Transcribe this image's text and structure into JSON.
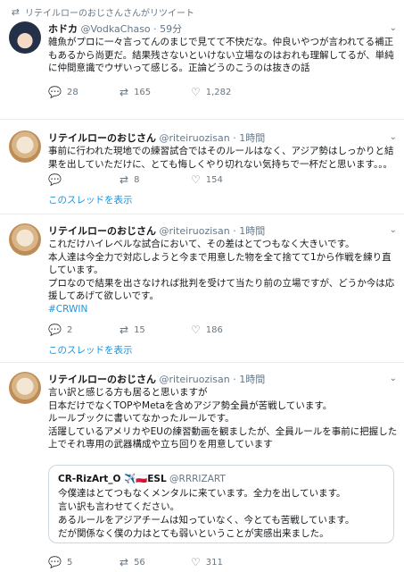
{
  "retweet_notice": "リテイルローのおじさんさんがリツイート",
  "tweets": [
    {
      "name": "ホドカ",
      "handle": "@VodkaChaso",
      "time": "59分",
      "text": "雑魚がプロに一々言ってんのまじで見てて不快だな。仲良いやつが言われてる補正もあるから尚更だ。結果残さないといけない立場なのはおれも理解してるが、単純に仲間意識でウザいって感じる。正論どうのこうのは抜きの話",
      "replies": "28",
      "retweets": "165",
      "likes": "1,282"
    },
    {
      "name": "リテイルローのおじさん",
      "handle": "@riteiruozisan",
      "time": "1時間",
      "text": "事前に行われた現地での練習試合ではそのルールはなく、アジア勢はしっかりと結果を出していただけに、とても悔しくやり切れない気持ちで一杯だと思います。。。",
      "replies": "",
      "retweets": "8",
      "likes": "154",
      "thread_link": "このスレッドを表示"
    },
    {
      "name": "リテイルローのおじさん",
      "handle": "@riteiruozisan",
      "time": "1時間",
      "text": "これだけハイレベルな試合において、その差はとてつもなく大きいです。\n本人達は今全力で対応しようと今まで用意した物を全て捨てて1から作戦を練り直しています。\nプロなので結果を出さなければ批判を受けて当たり前の立場ですが、どうか今は応援してあげて欲しいです。",
      "hashtag": "#CRWIN",
      "replies": "2",
      "retweets": "15",
      "likes": "186",
      "thread_link": "このスレッドを表示"
    },
    {
      "name": "リテイルローのおじさん",
      "handle": "@riteiruozisan",
      "time": "1時間",
      "text": "言い訳と感じる方も居ると思いますが\n日本だけでなくTOPやMetaを含めアジア勢全員が苦戦しています。\nルールブックに書いてなかったルールです。\n活躍しているアメリカやEUの練習動画を観ましたが、全員ルールを事前に把握した上でそれ専用の武器構成や立ち回りを用意しています",
      "replies": "5",
      "retweets": "56",
      "likes": "311",
      "quote": {
        "name": "CR-RizArt_O ✈️🇵🇱ESL",
        "handle": "@RRRIZART",
        "text": "今僕達はとてつもなくメンタルに来ています。全力を出しています。\n言い訳も言わせてください。\nあるルールをアジアチームは知っていなく、今とても苦戦しています。\nだが関係なく僕の力はとても弱いということが実感出来ました。"
      }
    }
  ],
  "icons": {
    "reply": "reply-icon",
    "retweet": "retweet-icon",
    "like": "heart-icon",
    "more": "chevron-down-icon"
  },
  "colors": {
    "link": "#1b95e0",
    "muted": "#657786",
    "border": "#e6ecf0"
  }
}
